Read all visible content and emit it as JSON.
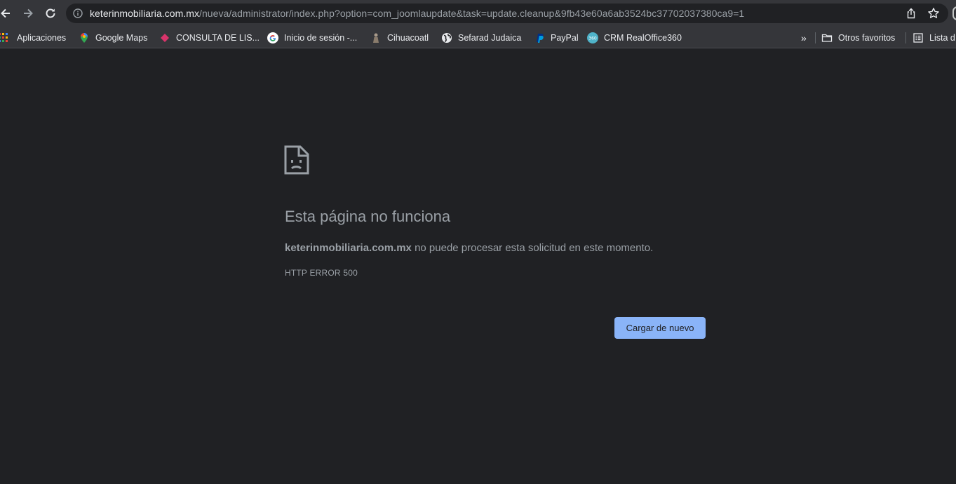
{
  "browser": {
    "url_host": "keterinmobiliaria.com.mx",
    "url_path": "/nueva/administrator/index.php?option=com_joomlaupdate&task=update.cleanup&9fb43e60a6ab3524bc37702037380ca9=1"
  },
  "bookmarks": {
    "items": [
      {
        "label": "Aplicaciones",
        "icon": "apps-grid-icon"
      },
      {
        "label": "Google Maps",
        "icon": "maps-pin-icon"
      },
      {
        "label": "CONSULTA DE LIS...",
        "icon": "diamond-icon"
      },
      {
        "label": "Inicio de sesión -...",
        "icon": "google-g-icon"
      },
      {
        "label": "Cihuacoatl",
        "icon": "figure-icon"
      },
      {
        "label": "Sefarad Judaica",
        "icon": "globe-icon"
      },
      {
        "label": "PayPal",
        "icon": "paypal-icon"
      },
      {
        "label": "CRM RealOffice360",
        "icon": "realoffice360-icon"
      }
    ],
    "overflow_label": "»",
    "other_favorites": "Otros favoritos",
    "reading_list": "Lista d"
  },
  "error_page": {
    "title": "Esta página no funciona",
    "host": "keterinmobiliaria.com.mx",
    "message": " no puede procesar esta solicitud en este momento.",
    "code": "HTTP ERROR 500",
    "reload_label": "Cargar de nuevo"
  },
  "colors": {
    "page_bg": "#202124",
    "toolbar_bg": "#35363a",
    "button_bg": "#8ab4f8",
    "text_muted": "#9aa0a6"
  }
}
